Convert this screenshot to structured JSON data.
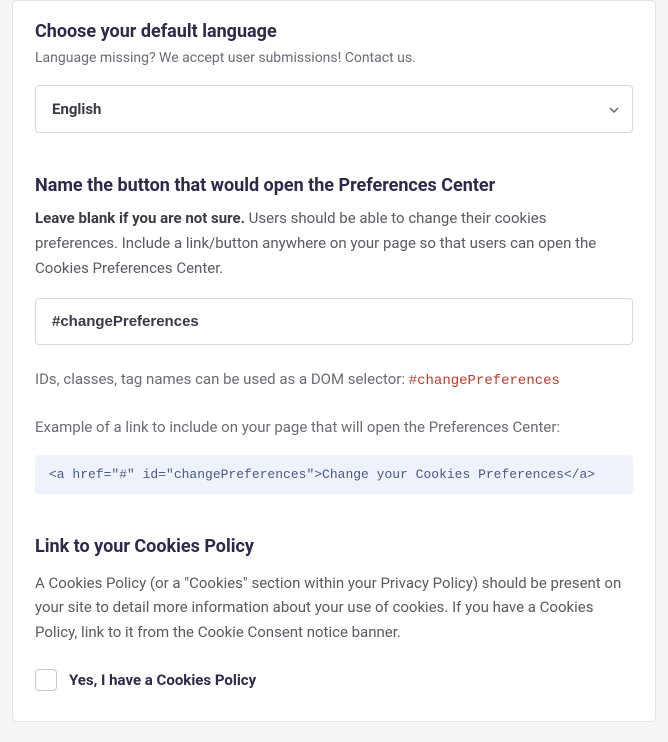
{
  "language": {
    "heading": "Choose your default language",
    "sub": "Language missing? We accept user submissions! Contact us.",
    "selected": "English"
  },
  "prefs": {
    "heading": "Name the button that would open the Preferences Center",
    "bold": "Leave blank if you are not sure.",
    "rest": " Users should be able to change their cookies preferences. Include a link/button anywhere on your page so that users can open the Cookies Preferences Center.",
    "value": "#changePreferences",
    "hint_prefix": "IDs, classes, tag names can be used as a DOM selector: ",
    "hint_code": "#changePreferences",
    "example_label": "Example of a link to include on your page that will open the Preferences Center:",
    "example_code": "<a href=\"#\" id=\"changePreferences\">Change your Cookies Preferences</a>"
  },
  "policy": {
    "heading": "Link to your Cookies Policy",
    "desc": "A Cookies Policy (or a \"Cookies\" section within your Privacy Policy) should be present on your site to detail more information about your use of cookies. If you have a Cookies Policy, link to it from the Cookie Consent notice banner.",
    "checkbox_label": "Yes, I have a Cookies Policy"
  }
}
